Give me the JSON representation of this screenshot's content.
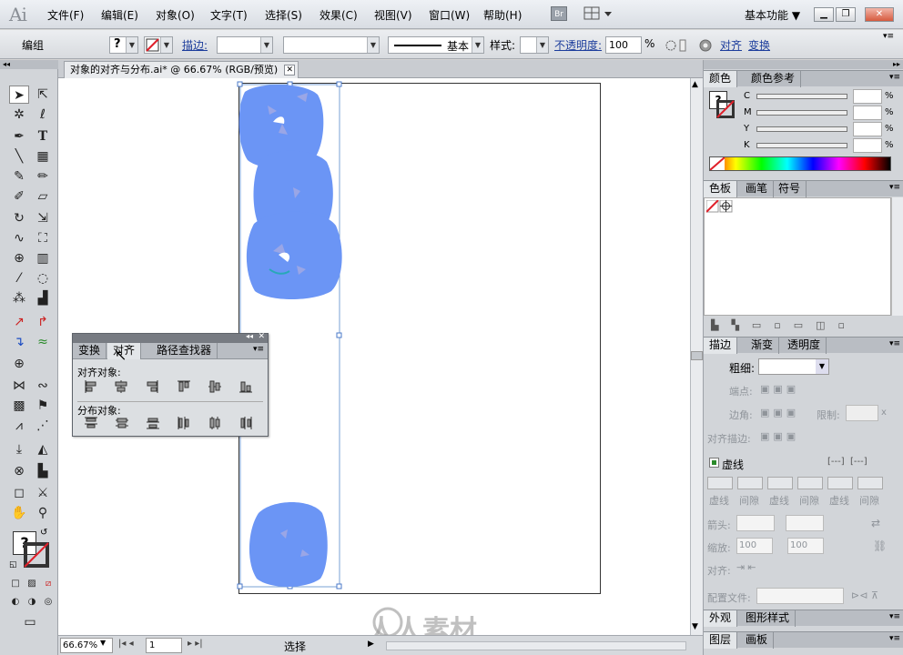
{
  "app": {
    "logo": "Ai"
  },
  "menu": [
    "文件(F)",
    "编辑(E)",
    "对象(O)",
    "文字(T)",
    "选择(S)",
    "效果(C)",
    "视图(V)",
    "窗口(W)",
    "帮助(H)"
  ],
  "titlebar": {
    "bridge": "Br",
    "workspace": "基本功能 ▼",
    "minimize": "▁",
    "restore": "❐",
    "close": "✕"
  },
  "control": {
    "selection": "编组",
    "stroke_label": "描边:",
    "brush_style": "基本",
    "style_label": "样式:",
    "opacity_label": "不透明度:",
    "opacity_value": "100",
    "opacity_unit": "%",
    "align_link": "对齐",
    "transform_link": "变换",
    "help_glyph": "?"
  },
  "document": {
    "tab_title": "对象的对齐与分布.ai* @ 66.67% (RGB/预览)",
    "close": "✕"
  },
  "status": {
    "zoom": "66.67%",
    "page": "1",
    "tool": "选择"
  },
  "color_panel": {
    "tabs": [
      "颜色",
      "颜色参考"
    ],
    "channels": [
      "C",
      "M",
      "Y",
      "K"
    ],
    "percent": "%"
  },
  "swatch_panel": {
    "tabs": [
      "色板",
      "画笔",
      "符号"
    ]
  },
  "stroke_panel": {
    "tabs": [
      "描边",
      "渐变",
      "透明度"
    ],
    "weight_label": "粗细:",
    "cap_label": "端点:",
    "corner_label": "边角:",
    "limit_label": "限制:",
    "limit_unit": "x",
    "align_stroke_label": "对齐描边:",
    "dashed_label": "虚线",
    "dash_labels": [
      "虚线",
      "间隙",
      "虚线",
      "间隙",
      "虚线",
      "间隙"
    ],
    "arrow_label": "箭头:",
    "scale_label": "缩放:",
    "scale_value_1": "100",
    "scale_value_2": "100",
    "align_label": "对齐:",
    "profile_label": "配置文件:"
  },
  "appearance_panel": {
    "tabs": [
      "外观",
      "图形样式"
    ]
  },
  "layers_panel": {
    "tabs": [
      "图层",
      "画板"
    ]
  },
  "align_panel": {
    "tabs": [
      "变换",
      "对齐",
      "路径查找器"
    ],
    "align_objects": "对齐对象:",
    "distribute_objects": "分布对象:"
  },
  "watermark": "人人素材",
  "colors": {
    "shape_blue": "#6b95f5",
    "selection_line": "#7aa0d6",
    "panel_bg": "#d2d5d9"
  }
}
